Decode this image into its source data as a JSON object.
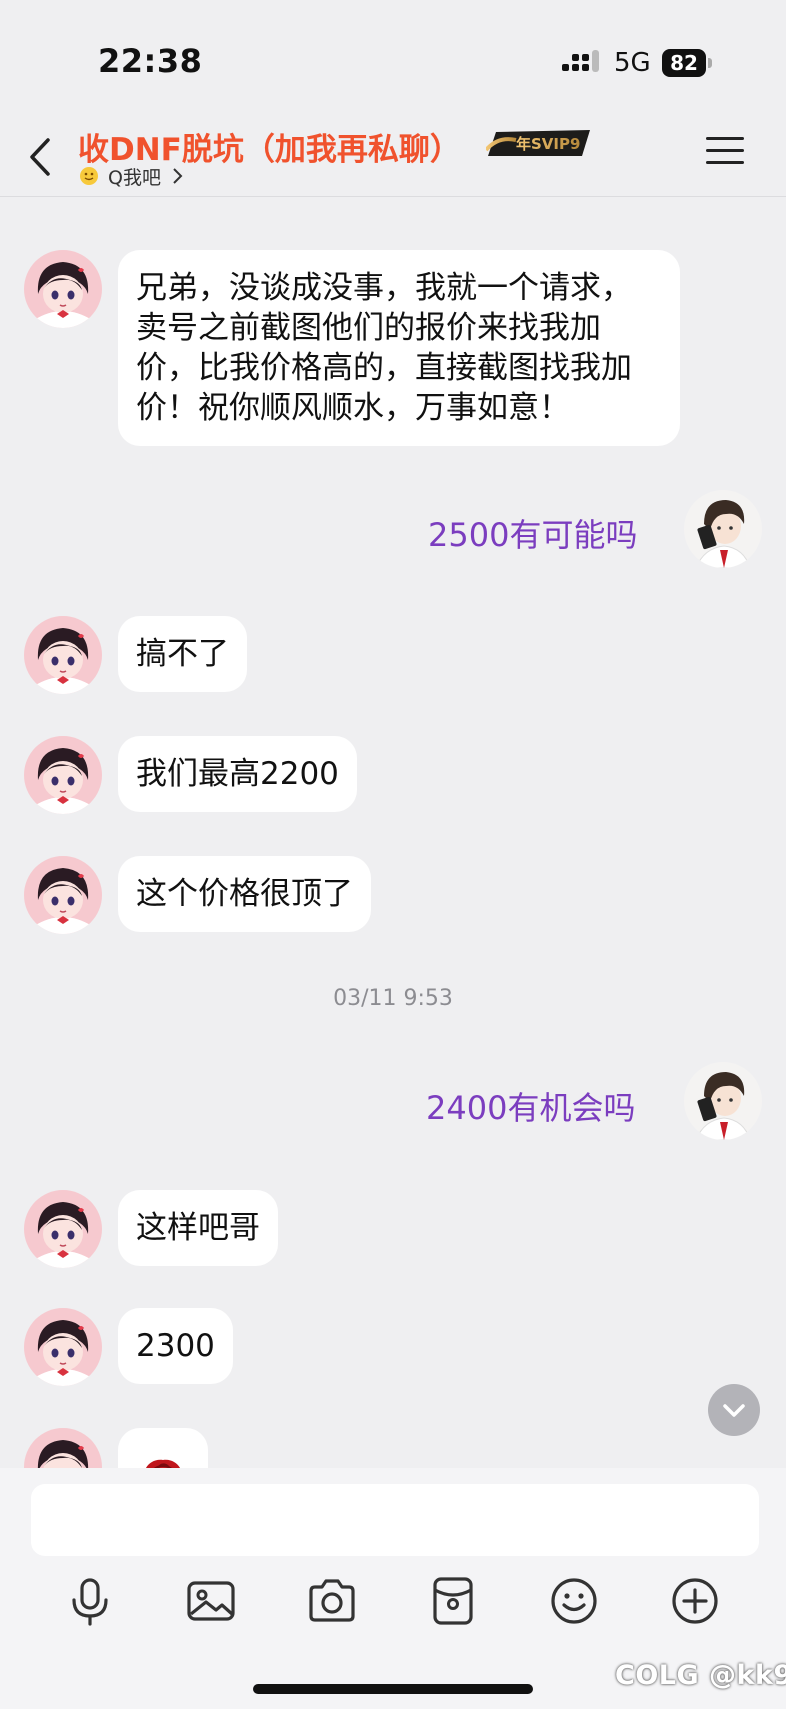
{
  "status_bar": {
    "time": "22:38",
    "network": "5G",
    "battery": "82"
  },
  "header": {
    "title": "收DNF脱坑（加我再私聊）",
    "badge": "年SVIP9",
    "subtitle": "Q我吧"
  },
  "messages": [
    {
      "side": "in",
      "text": "兄弟，没谈成没事，我就一个请求，卖号之前截图他们的报价来找我加价，比我价格高的，直接截图找我加价！祝你顺风顺水，万事如意！"
    },
    {
      "side": "out",
      "text": "2500有可能吗"
    },
    {
      "side": "in",
      "text": "搞不了"
    },
    {
      "side": "in",
      "text": "我们最高2200"
    },
    {
      "side": "in",
      "text": "这个价格很顶了"
    },
    {
      "side": "timestamp",
      "text": "03/11 9:53"
    },
    {
      "side": "out",
      "text": "2400有机会吗"
    },
    {
      "side": "in",
      "text": "这样吧哥"
    },
    {
      "side": "in",
      "text": "2300"
    },
    {
      "side": "in",
      "text": "",
      "icon": "rose-icon"
    }
  ],
  "composer": {
    "placeholder": "",
    "tools": [
      "microphone-icon",
      "image-icon",
      "camera-icon",
      "red-packet-icon",
      "emoji-icon",
      "plus-icon"
    ]
  },
  "watermark": "COLG @kk9",
  "colors": {
    "title": "#f0522d",
    "outgoing_text": "#7b3dbf",
    "background": "#efeff1"
  }
}
